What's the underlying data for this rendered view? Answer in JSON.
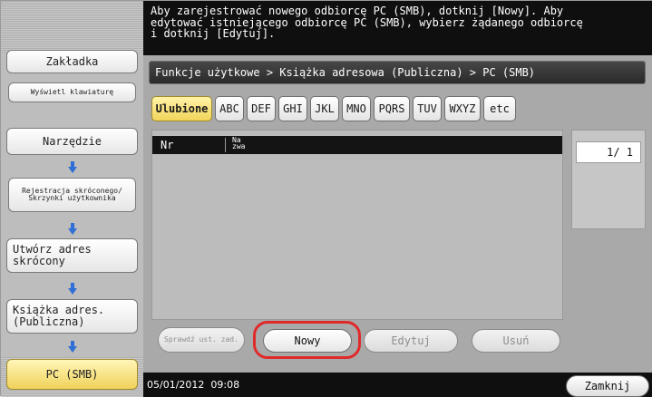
{
  "message": "Aby zarejestrować nowego odbiorcę PC (SMB), dotknij [Nowy]. Aby\nedytować istniejącego odbiorcę PC (SMB), wybierz żądanego odbiorcę\ni dotknij [Edytuj].",
  "sidebar": {
    "zakladka": "Zakładka",
    "wyswietl_klawiature": "Wyświetl klawiaturę",
    "narzedzie": "Narzędzie",
    "rejestracja": "Rejestracja skróconego/ Skrzynki użytkownika",
    "utworz_adres": "Utwórz adres skrócony",
    "ksiazka_adres": "Książka adres. (Publiczna)",
    "pc_smb": "PC (SMB)"
  },
  "breadcrumb": "Funkcje użytkowe > Książka adresowa (Publiczna) > PC (SMB)",
  "tabs": [
    "Ulubione",
    "ABC",
    "DEF",
    "GHI",
    "JKL",
    "MNO",
    "PQRS",
    "TUV",
    "WXYZ",
    "etc"
  ],
  "list": {
    "col_nr": "Nr",
    "col_nazwa": "Na\nzwa"
  },
  "pager": "1/ 1",
  "actions": {
    "sprawdz": "Sprawdź ust. zad.",
    "nowy": "Nowy",
    "edytuj": "Edytuj",
    "usun": "Usuń"
  },
  "status": {
    "date": "05/01/2012",
    "time": "09:08",
    "zamknij": "Zamknij"
  },
  "colors": {
    "accent_gold": "#f1d45a",
    "highlight_red": "#e02a2a",
    "arrow_blue": "#2f6fd6"
  }
}
